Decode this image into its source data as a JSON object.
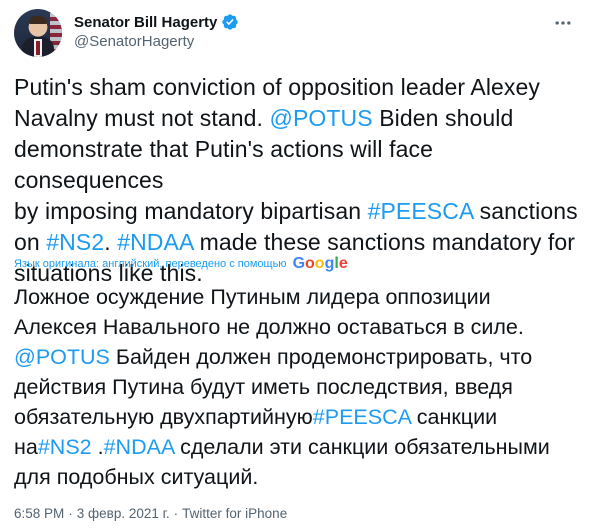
{
  "author": {
    "name": "Senator Bill Hagerty",
    "handle": "@SenatorHagerty"
  },
  "tweet": {
    "parts": [
      {
        "text": "Putin's sham conviction of opposition leader Alexey\nNavalny must not stand. ",
        "link": false
      },
      {
        "text": "@POTUS",
        "link": true
      },
      {
        "text": " Biden should\ndemonstrate that Putin's actions will face consequences\nby imposing mandatory bipartisan ",
        "link": false
      },
      {
        "text": "#PEESCA",
        "link": true
      },
      {
        "text": " sanctions\non ",
        "link": false
      },
      {
        "text": "#NS2",
        "link": true
      },
      {
        "text": ". ",
        "link": false
      },
      {
        "text": "#NDAA",
        "link": true
      },
      {
        "text": " made these sanctions mandatory for\nsituations like this.",
        "link": false
      }
    ]
  },
  "translation_note": "Язык оригинала: английский, переведено с помощью",
  "translation_provider": "Google",
  "translated": {
    "line1": "Ложное осуждение Путиным лидера оппозиции",
    "line2": "Алексея Навального не должно оставаться в силе.",
    "line3_link": "@POTUS",
    "line3_text": " Байден должен продемонстрировать, что",
    "line4": "действия Путина будут иметь последствия, введя",
    "line5_text": "обязательную двухпартийную",
    "line5_link": "#PEESCA",
    "line5_text2": " санкции",
    "line6_text": "на",
    "line6_link1": "#NS2",
    "line6_text2": " .",
    "line6_link2": "#NDAA",
    "line6_text3": " сделали эти санкции обязательными",
    "line7": "для подобных ситуаций."
  },
  "meta": {
    "time": "6:58 PM",
    "separator": "·",
    "date": "3 февр. 2021 г.",
    "client": "Twitter for iPhone"
  },
  "colors": {
    "link": "#1d9bf0",
    "text": "#0f1419",
    "secondary": "#536471"
  },
  "icons": [
    "verified-badge-icon",
    "more-options-icon",
    "google-logo"
  ]
}
